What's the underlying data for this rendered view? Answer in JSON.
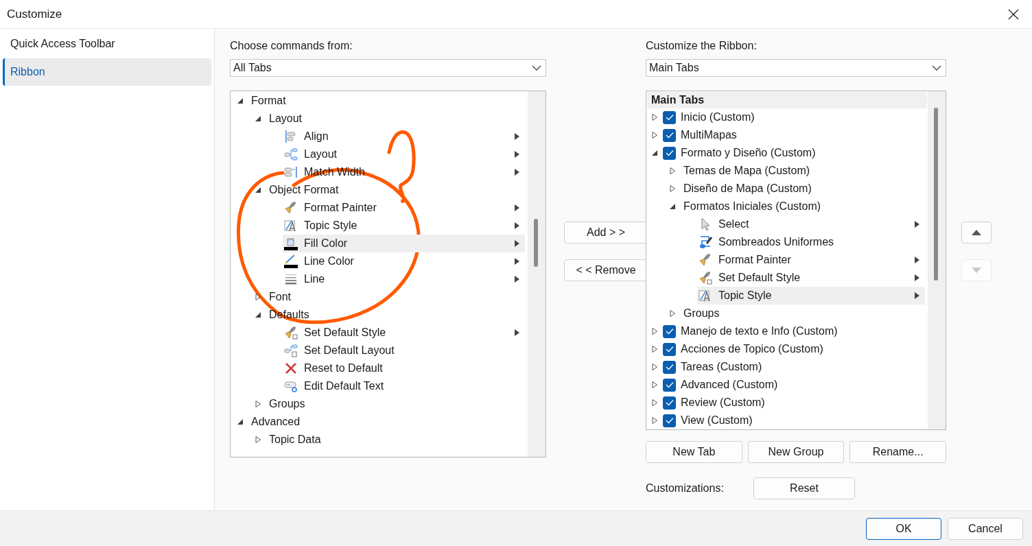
{
  "window": {
    "title": "Customize"
  },
  "sidebar": {
    "items": [
      {
        "label": "Quick Access Toolbar",
        "selected": false
      },
      {
        "label": "Ribbon",
        "selected": true
      }
    ]
  },
  "left_panel": {
    "label": "Choose commands from:",
    "dropdown": {
      "value": "All Tabs"
    },
    "tree": [
      {
        "label": "Format",
        "expanded": true,
        "children": [
          {
            "label": "Layout",
            "expanded": true,
            "children": [
              {
                "label": "Align",
                "submenu": true,
                "selected": false
              },
              {
                "label": "Layout",
                "submenu": true,
                "selected": false
              },
              {
                "label": "Match Width",
                "submenu": true,
                "selected": false
              }
            ]
          },
          {
            "label": "Object Format",
            "expanded": true,
            "children": [
              {
                "label": "Format Painter",
                "submenu": true,
                "selected": false
              },
              {
                "label": "Topic Style",
                "submenu": true,
                "selected": false
              },
              {
                "label": "Fill Color",
                "submenu": true,
                "selected": true
              },
              {
                "label": "Line Color",
                "submenu": true,
                "selected": false
              },
              {
                "label": "Line",
                "submenu": true,
                "selected": false
              }
            ]
          },
          {
            "label": "Font",
            "expanded": false
          },
          {
            "label": "Defaults",
            "expanded": true,
            "children": [
              {
                "label": "Set Default Style",
                "submenu": true,
                "selected": false
              },
              {
                "label": "Set Default Layout",
                "submenu": false,
                "selected": false
              },
              {
                "label": "Reset to Default",
                "submenu": false,
                "selected": false
              },
              {
                "label": "Edit Default Text",
                "submenu": false,
                "selected": false
              }
            ]
          },
          {
            "label": "Groups",
            "expanded": false
          }
        ]
      },
      {
        "label": "Advanced",
        "expanded": true,
        "children": [
          {
            "label": "Topic Data",
            "expanded": false
          }
        ]
      }
    ]
  },
  "middle_buttons": [
    {
      "label": "Add > >"
    },
    {
      "label": "< < Remove"
    }
  ],
  "right_panel": {
    "label": "Customize the Ribbon:",
    "dropdown": {
      "value": "Main Tabs"
    },
    "tree_header": "Main Tabs",
    "tree": [
      {
        "label": "Inicio (Custom)",
        "expanded": false,
        "checked": true
      },
      {
        "label": "MultiMapas",
        "expanded": false,
        "checked": true
      },
      {
        "label": "Formato y Diseño (Custom)",
        "expanded": true,
        "checked": true,
        "children": [
          {
            "label": "Temas de Mapa (Custom)",
            "expanded": false
          },
          {
            "label": "Diseño de Mapa (Custom)",
            "expanded": false
          },
          {
            "label": "Formatos Iniciales (Custom)",
            "expanded": true,
            "children": [
              {
                "label": "Select",
                "submenu": true,
                "selected": false
              },
              {
                "label": "Sombreados Uniformes",
                "submenu": false,
                "selected": false
              },
              {
                "label": "Format Painter",
                "submenu": true,
                "selected": false
              },
              {
                "label": "Set Default Style",
                "submenu": true,
                "selected": false
              },
              {
                "label": "Topic Style",
                "submenu": true,
                "selected": true
              }
            ]
          },
          {
            "label": "Groups",
            "expanded": false
          }
        ]
      },
      {
        "label": "Manejo de texto e Info (Custom)",
        "expanded": false,
        "checked": true
      },
      {
        "label": "Acciones de Topico (Custom)",
        "expanded": false,
        "checked": true
      },
      {
        "label": "Tareas (Custom)",
        "expanded": false,
        "checked": true
      },
      {
        "label": "Advanced (Custom)",
        "expanded": false,
        "checked": true
      },
      {
        "label": "Review (Custom)",
        "expanded": false,
        "checked": true
      },
      {
        "label": "View (Custom)",
        "expanded": false,
        "checked": true
      }
    ],
    "buttons": [
      {
        "label": "New Tab"
      },
      {
        "label": "New Group"
      },
      {
        "label": "Rename..."
      }
    ],
    "customizations": {
      "label": "Customizations:",
      "button": "Reset"
    }
  },
  "move_buttons": [
    {
      "disabled": false
    },
    {
      "disabled": true
    }
  ],
  "footer": {
    "buttons": [
      {
        "label": "OK",
        "default": true
      },
      {
        "label": "Cancel",
        "default": false
      }
    ]
  }
}
